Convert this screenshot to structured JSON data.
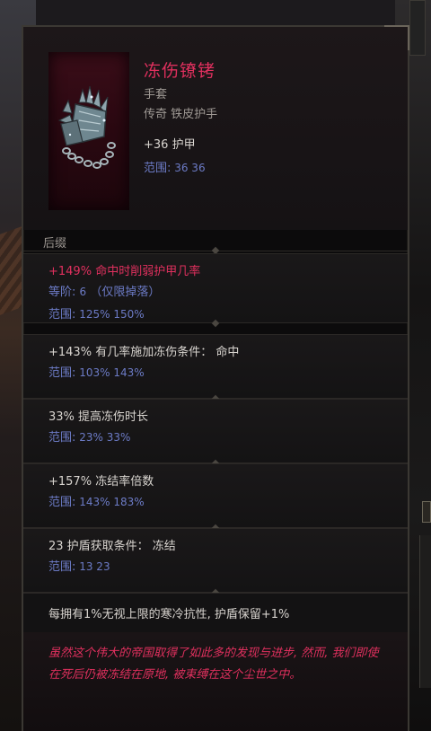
{
  "item": {
    "name": "冻伤镣铐",
    "type": "手套",
    "subtype": "传奇 铁皮护手",
    "implicit": "+36 护甲",
    "implicit_range": {
      "label": "范围:",
      "values": "36   36"
    }
  },
  "section_label": "后缀",
  "affixes": [
    {
      "text": "+149% 命中时削弱护甲几率",
      "tier": {
        "label": "等阶:",
        "value": "6",
        "note": "（仅限掉落）"
      },
      "range": {
        "label": "范围:",
        "values": "125%   150%"
      }
    },
    {
      "text": "+143% 有几率施加冻伤条件：  命中",
      "range": {
        "label": "范围:",
        "values": "103%   143%"
      }
    },
    {
      "text": "33% 提高冻伤时长",
      "range": {
        "label": "范围:",
        "values": "23%   33%"
      }
    },
    {
      "text": "+157% 冻结率倍数",
      "range": {
        "label": "范围:",
        "values": "143%   183%"
      }
    },
    {
      "text": "23 护盾获取条件：  冻结",
      "range": {
        "label": "范围:",
        "values": "13   23"
      }
    }
  ],
  "special_effect": "每拥有1%无视上限的寒冷抗性, 护盾保留+1%",
  "lore": "虽然这个伟大的帝国取得了如此多的发现与进步, 然而, 我们即使在死后仍被冻结在原地, 被束缚在这个尘世之中。",
  "colors": {
    "unique_name": "#e0305e",
    "range": "#6c7bc6",
    "text": "#d8d4cf",
    "muted": "#9f9994"
  }
}
